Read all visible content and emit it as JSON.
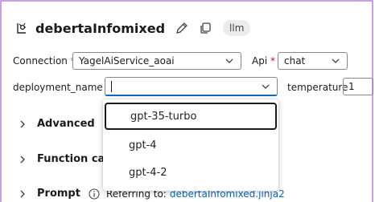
{
  "header": {
    "title": "debertaInfomixed",
    "badge": "llm"
  },
  "form": {
    "connection_label": "Connection",
    "connection_value": "YagelAiService_aoai",
    "api_label": "Api",
    "api_value": "chat",
    "deployment_label": "deployment_name",
    "deployment_value": "",
    "temperature_label": "temperature",
    "temperature_value": "1",
    "required_mark": "*"
  },
  "sections": {
    "advanced": "Advanced",
    "function": "Function calli",
    "prompt": "Prompt"
  },
  "prompt": {
    "referring_text": "Referring to:",
    "referring_link": "debertaInfomixed.jinja2"
  },
  "dropdown": {
    "options": [
      "gpt-35-turbo",
      "gpt-4",
      "gpt-4-2"
    ],
    "highlighted_index": 0
  },
  "colors": {
    "accent": "#0f6cbd",
    "required": "#c50f1f",
    "border_highlight": "#c9a0dc"
  },
  "icons": {
    "node": "llm-node-icon",
    "edit": "pencil-icon",
    "copy": "copy-icon",
    "chevron": "chevron-down-icon",
    "expand": "chevron-right-icon",
    "info": "info-icon"
  }
}
